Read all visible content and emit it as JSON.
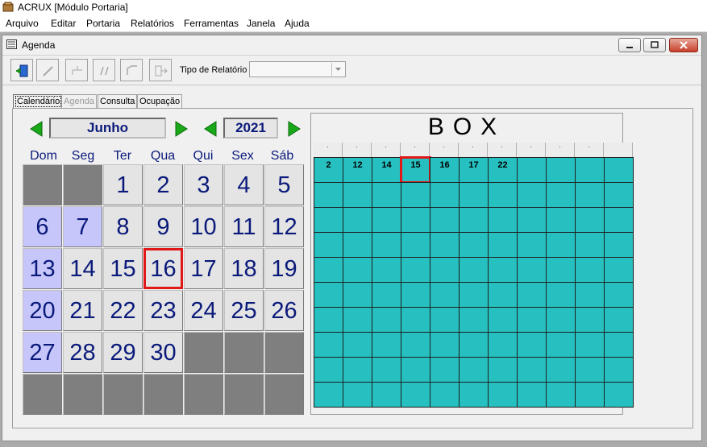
{
  "app": {
    "title": "ACRUX [Módulo Portaria]"
  },
  "menu": [
    "Arquivo",
    "Editar",
    "Portaria",
    "Relatórios",
    "Ferramentas",
    "Janela",
    "Ajuda"
  ],
  "window": {
    "title": "Agenda"
  },
  "toolbar": {
    "buttons": [
      "exit-icon",
      "edit-icon",
      "tree-icon",
      "pair-icon",
      "shape-icon",
      "export-icon"
    ],
    "tipo_relatorio_label": "Tipo de Relatório",
    "tipo_relatorio_value": ""
  },
  "tabs": [
    {
      "label": "Calendário",
      "active": true
    },
    {
      "label": "Agenda",
      "active": false,
      "disabled": true
    },
    {
      "label": "Consulta",
      "active": false
    },
    {
      "label": "Ocupação",
      "active": false
    }
  ],
  "calendar": {
    "month": "Junho",
    "year": "2021",
    "weekdays": [
      "Dom",
      "Seg",
      "Ter",
      "Qua",
      "Qui",
      "Sex",
      "Sáb"
    ],
    "selected_day": "16",
    "weeks": [
      [
        "",
        "",
        "1",
        "2",
        "3",
        "4",
        "5"
      ],
      [
        "6",
        "7",
        "8",
        "9",
        "10",
        "11",
        "12"
      ],
      [
        "13",
        "14",
        "15",
        "16",
        "17",
        "18",
        "19"
      ],
      [
        "20",
        "21",
        "22",
        "23",
        "24",
        "25",
        "26"
      ],
      [
        "27",
        "28",
        "29",
        "30",
        "",
        "",
        ""
      ],
      [
        "",
        "",
        "",
        "",
        "",
        "",
        ""
      ]
    ],
    "highlighted_days": [
      "6",
      "7",
      "13",
      "20",
      "27"
    ]
  },
  "box": {
    "title": "BOX",
    "column_headers": [
      ".",
      ".",
      ".",
      ".",
      ".",
      ".",
      ".",
      ".",
      ".",
      "."
    ],
    "first_row": [
      "2",
      "12",
      "14",
      "15",
      "16",
      "17",
      "22",
      "",
      "",
      "",
      ""
    ],
    "selected_value": "15",
    "rows": 10,
    "cols": 11,
    "colors": {
      "cell": "#26c0c0",
      "selection": "#e01818"
    }
  },
  "colors": {
    "accent_text": "#0a1a7a",
    "weekend": "#c6c6fa",
    "nav_green": "#19a819"
  }
}
